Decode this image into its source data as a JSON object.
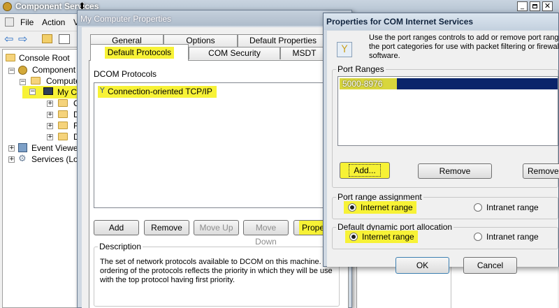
{
  "main_window": {
    "title": "Component Services",
    "menu": [
      "File",
      "Action",
      "V"
    ],
    "tree": {
      "console_root": "Console Root",
      "component_services": "Component S",
      "computers": "Compute",
      "my_computer": "My C",
      "children": [
        "C",
        "D",
        "R",
        "D"
      ],
      "event_viewer": "Event Viewer",
      "services": "Services (Loc"
    }
  },
  "my_computer_dialog": {
    "title": "My Computer Properties",
    "tabs_back": [
      "General",
      "Options",
      "Default Properties"
    ],
    "tabs_front": [
      "Default Protocols",
      "COM Security",
      "MSDT"
    ],
    "protocols_label": "DCOM Protocols",
    "protocol_item": "Connection-oriented TCP/IP",
    "buttons": {
      "add": "Add",
      "remove": "Remove",
      "move_up": "Move Up",
      "move_down": "Move Down",
      "properties": "Properti"
    },
    "description_label": "Description",
    "description_text": [
      "The set of network protocols available to DCOM on this machine. T",
      "ordering of the protocols reflects the priority in which they will be use",
      "with the top protocol having first priority."
    ]
  },
  "com_internet_dialog": {
    "title": "Properties for COM Internet Services",
    "intro": [
      "Use the port ranges controls to add or remove port ranges",
      "the port categories for use with packet filtering or firewall",
      "software."
    ],
    "port_ranges_label": "Port Ranges",
    "port_range_value": "5000-8976",
    "buttons": {
      "add": "Add...",
      "remove": "Remove",
      "remove_all": "Remove",
      "ok": "OK",
      "cancel": "Cancel"
    },
    "assignment_label": "Port range assignment",
    "assignment_internet": "Internet range",
    "assignment_intranet": "Intranet range",
    "allocation_label": "Default dynamic port allocation",
    "allocation_internet": "Internet range",
    "allocation_intranet": "Intranet range"
  },
  "colors": {
    "highlight": "#f7f236",
    "selection": "#0a246a",
    "dialog_bg": "#f0f0f0"
  }
}
